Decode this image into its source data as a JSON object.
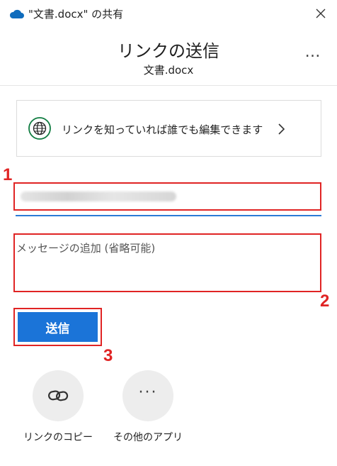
{
  "window": {
    "title": "\"文書.docx\" の共有",
    "close_icon": "close-icon",
    "app_icon": "onedrive-cloud-icon"
  },
  "header": {
    "title": "リンクの送信",
    "subtitle": "文書.docx",
    "more_label": "…"
  },
  "link_settings": {
    "label": "リンクを知っていれば誰でも編集できます",
    "icon": "globe-icon",
    "chevron": "chevron-right-icon"
  },
  "recipients": {
    "value": "(blurred address)"
  },
  "message": {
    "placeholder": "メッセージの追加 (省略可能)"
  },
  "send_button": {
    "label": "送信"
  },
  "annotations": {
    "step1": "1",
    "step2": "2",
    "step3": "3",
    "color": "#e02424"
  },
  "actions": [
    {
      "label": "リンクのコピー",
      "icon": "link-icon"
    },
    {
      "label": "その他のアプリ",
      "icon": "more-apps-icon",
      "glyph": "···"
    }
  ],
  "colors": {
    "accent": "#1b74d8",
    "highlight": "#e02424",
    "icon_circle": "#ededed"
  }
}
